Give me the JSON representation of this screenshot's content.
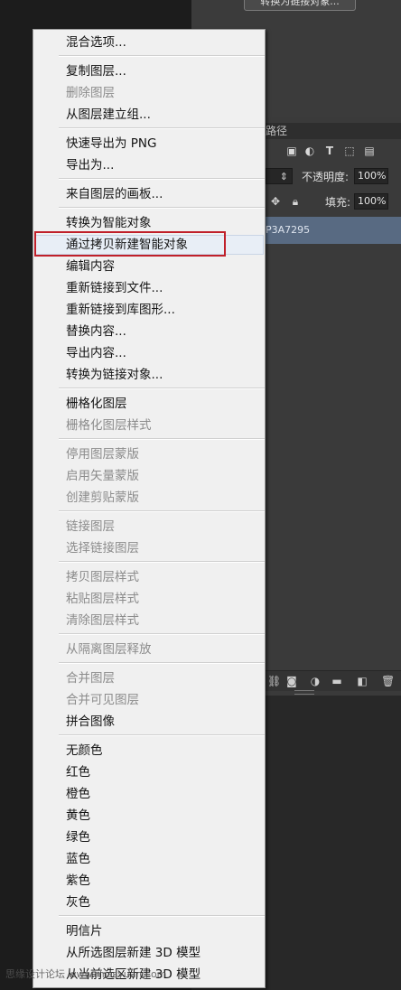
{
  "top_button": {
    "label": "转换为链接对象..."
  },
  "layers_panel": {
    "tab_paths": "路径",
    "filter_icons": [
      "image-filter-icon",
      "adjustment-filter-icon",
      "type-filter-icon",
      "shape-filter-icon",
      "smart-object-filter-icon"
    ],
    "opacity_label": "不透明度:",
    "opacity_value": "100%",
    "fill_label": "填充:",
    "fill_value": "100%",
    "layer_name": "P3A7295",
    "bottom_icons": [
      "link-icon",
      "mask-icon",
      "adjustment-icon",
      "folder-icon",
      "new-layer-icon",
      "trash-icon"
    ]
  },
  "context_menu": {
    "items": [
      {
        "label": "混合选项...",
        "enabled": true
      },
      {
        "label": "复制图层...",
        "enabled": true
      },
      {
        "label": "删除图层",
        "enabled": false
      },
      {
        "label": "从图层建立组...",
        "enabled": true
      },
      {
        "label": "快速导出为 PNG",
        "enabled": true
      },
      {
        "label": "导出为...",
        "enabled": true
      },
      {
        "label": "来自图层的画板...",
        "enabled": true
      },
      {
        "label": "转换为智能对象",
        "enabled": true
      },
      {
        "label": "通过拷贝新建智能对象",
        "enabled": true,
        "highlighted": true
      },
      {
        "label": "编辑内容",
        "enabled": true
      },
      {
        "label": "重新链接到文件...",
        "enabled": true
      },
      {
        "label": "重新链接到库图形...",
        "enabled": true
      },
      {
        "label": "替换内容...",
        "enabled": true
      },
      {
        "label": "导出内容...",
        "enabled": true
      },
      {
        "label": "转换为链接对象...",
        "enabled": true
      },
      {
        "label": "栅格化图层",
        "enabled": true
      },
      {
        "label": "栅格化图层样式",
        "enabled": false
      },
      {
        "label": "停用图层蒙版",
        "enabled": false
      },
      {
        "label": "启用矢量蒙版",
        "enabled": false
      },
      {
        "label": "创建剪贴蒙版",
        "enabled": false
      },
      {
        "label": "链接图层",
        "enabled": false
      },
      {
        "label": "选择链接图层",
        "enabled": false
      },
      {
        "label": "拷贝图层样式",
        "enabled": false
      },
      {
        "label": "粘贴图层样式",
        "enabled": false
      },
      {
        "label": "清除图层样式",
        "enabled": false
      },
      {
        "label": "从隔离图层释放",
        "enabled": false
      },
      {
        "label": "合并图层",
        "enabled": false
      },
      {
        "label": "合并可见图层",
        "enabled": false
      },
      {
        "label": "拼合图像",
        "enabled": true
      },
      {
        "label": "无颜色",
        "enabled": true
      },
      {
        "label": "红色",
        "enabled": true
      },
      {
        "label": "橙色",
        "enabled": true
      },
      {
        "label": "黄色",
        "enabled": true
      },
      {
        "label": "绿色",
        "enabled": true
      },
      {
        "label": "蓝色",
        "enabled": true
      },
      {
        "label": "紫色",
        "enabled": true
      },
      {
        "label": "灰色",
        "enabled": true
      },
      {
        "label": "明信片",
        "enabled": true
      },
      {
        "label": "从所选图层新建 3D 模型",
        "enabled": true
      }
    ],
    "last_partial_item": "从当前选区新建 3D 模型"
  },
  "watermark": {
    "text": "思缘设计论坛",
    "url": "www.missyuan.com"
  }
}
